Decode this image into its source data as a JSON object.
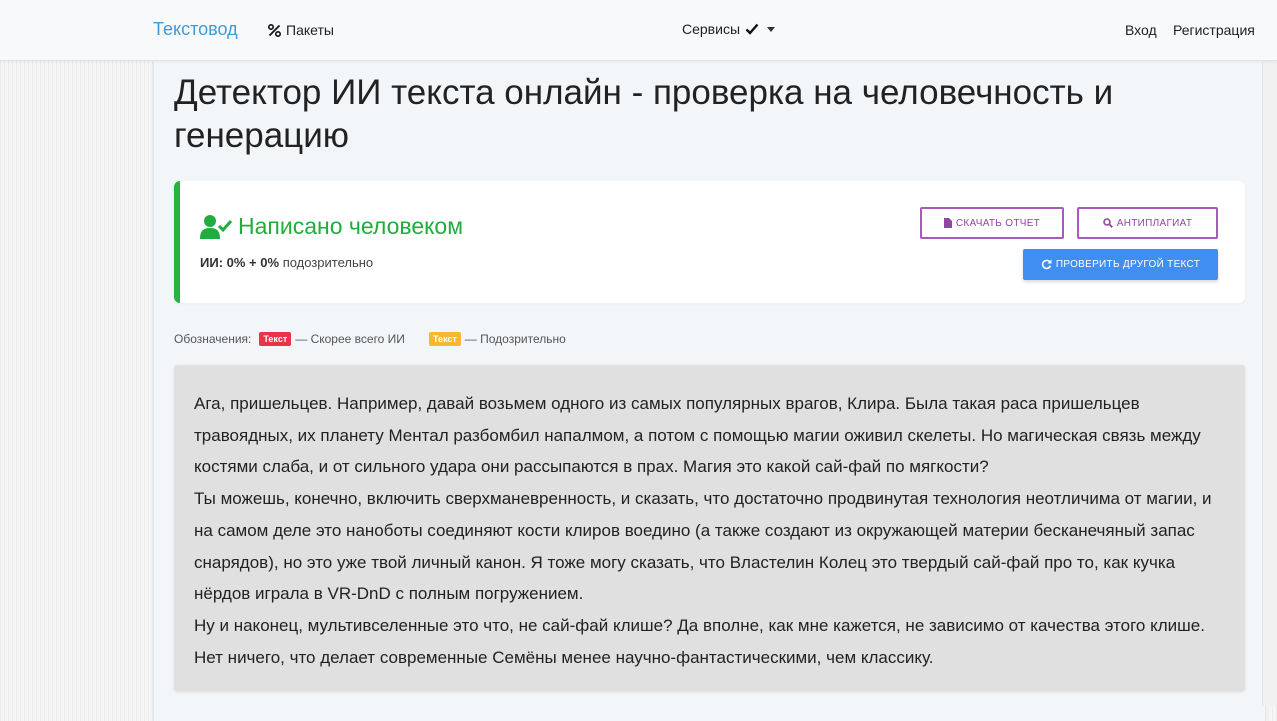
{
  "nav": {
    "brand": "Текстовод",
    "packages": "Пакеты",
    "services": "Сервисы",
    "login": "Вход",
    "register": "Регистрация"
  },
  "page": {
    "title": "Детектор ИИ текста онлайн - проверка на человечность и генерацию"
  },
  "result": {
    "verdict": "Написано человеком",
    "ai_label": "ИИ:",
    "ai_values": "0% + 0%",
    "suspicious_label": "подозрительно",
    "download_button": "Скачать отчет",
    "plagiarism_button": "Антиплагиат",
    "check_button": "Проверить другой текст"
  },
  "legend": {
    "label": "Обозначения:",
    "tag_text": "Текст",
    "ai_meaning": "— Скорее всего ИИ",
    "suspicious_meaning": "— Подозрительно"
  },
  "text": {
    "paragraphs": [
      " Ага, пришельцев. Например, давай возьмем одного из самых популярных врагов, Клира. Была такая раса пришельцев травоядных, их планету Ментал разбомбил напалмом, а потом с помощью магии оживил скелеты. Но магическая связь между костями слаба, и от сильного удара они рассыпаются в прах. Магия это какой сай-фай по мягкости?",
      "Ты можешь, конечно, включить сверхманевренность, и сказать, что достаточно продвинутая технология неотличима от магии, и на самом деле это наноботы соединяют кости клиров воедино (а также создают из окружающей материи бесканечяный запас снарядов), но это уже твой личный канон. Я тоже могу сказать, что Властелин Колец это твердый сай-фай про то, как кучка нёрдов играла в VR-DnD с полным погружением.",
      "Ну и наконец, мультивселенные это что, не сай-фай клише? Да вполне, как мне кажется, не зависимо от качества этого клише. Нет ничего, что делает современные Семёны менее научно-фантастическими, чем классику."
    ]
  },
  "colors": {
    "brand": "#3e9bd8",
    "human_green": "#1fae3e",
    "outline_purple": "#a55bb8",
    "primary_blue": "#3f8ef0",
    "ai_red": "#e8334a",
    "suspicious_yellow": "#f5b82e"
  },
  "icons": {
    "packages": "percent-icon",
    "services": "check-icon",
    "verdict": "user-check-icon",
    "download": "file-icon",
    "plagiarism": "search-icon",
    "check": "refresh-icon"
  }
}
